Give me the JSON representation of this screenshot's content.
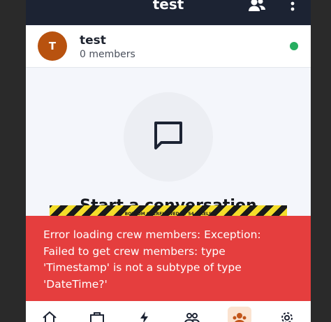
{
  "app_bar": {
    "title": "test",
    "members_icon": "people-icon",
    "menu_icon": "more-vert-icon"
  },
  "crew": {
    "avatar_initial": "T",
    "name": "test",
    "member_count": "0 members",
    "status_color": "#27ae60"
  },
  "empty_state": {
    "icon": "chat-bubble-icon",
    "title": "Start a conversation"
  },
  "debug_overflow": {
    "label": "BOTTOM OVERFLOWED BY 54 PIXELS"
  },
  "error_snackbar": {
    "message": "Error loading crew members: Exception: Failed to get crew members: type 'Timestamp' is not a subtype of type 'DateTime?'"
  },
  "bottom_nav": {
    "items": [
      {
        "icon": "home-icon"
      },
      {
        "icon": "briefcase-icon"
      },
      {
        "icon": "lightning-icon"
      },
      {
        "icon": "group-icon"
      },
      {
        "icon": "crew-icon",
        "active": true
      },
      {
        "icon": "settings-icon"
      }
    ]
  },
  "colors": {
    "app_bar": "#1c2333",
    "avatar": "#b8520f",
    "error": "#e53e3e",
    "accent": "#c2561b"
  }
}
